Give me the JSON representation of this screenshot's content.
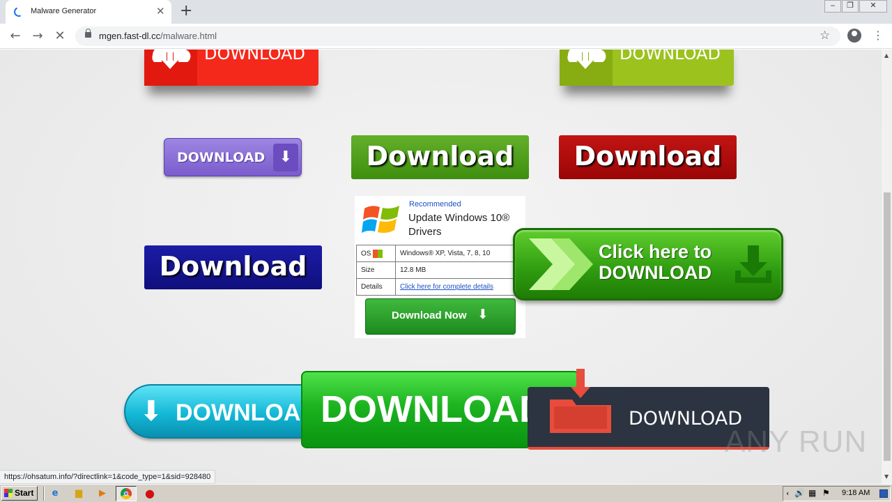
{
  "browser": {
    "tab_title": "Malware Generator",
    "url_host": "mgen.fast-dl.cc",
    "url_path": "/malware.html",
    "status_url": "https://ohsatum.info/?directlink=1&code_type=1&sid=928480"
  },
  "page": {
    "buttons": {
      "red_cloud": "DOWNLOAD",
      "lime_cloud": "DOWNLOAD",
      "purple": "DOWNLOAD",
      "green_bold": "Download",
      "red_bold": "Download",
      "navy_bold": "Download",
      "click_line1": "Click here to",
      "click_line2": "DOWNLOAD",
      "cyan": "DOWNLOAD",
      "big_green": "DOWNLOAD",
      "dark": "DOWNLOAD"
    },
    "ad": {
      "recommended": "Recommended",
      "title": "Update Windows 10® Drivers",
      "rows": [
        {
          "key": "OS",
          "value": "Windows® XP, Vista, 7, 8, 10"
        },
        {
          "key": "Size",
          "value": "12.8 MB"
        },
        {
          "key": "Details",
          "value": "Click here for complete details"
        }
      ],
      "button": "Download Now"
    },
    "watermark": "ANY RUN"
  },
  "taskbar": {
    "start": "Start",
    "clock": "9:18 AM"
  },
  "colors": {
    "red_cloud": "#f4291c",
    "lime_cloud": "#9cc21e",
    "purple": "#8a6fd6",
    "green_bold": "#4a9a15",
    "red_bold": "#b00a0a",
    "navy_bold": "#14148f",
    "dark": "#2b3440",
    "accent_orange": "#e74c3c"
  }
}
